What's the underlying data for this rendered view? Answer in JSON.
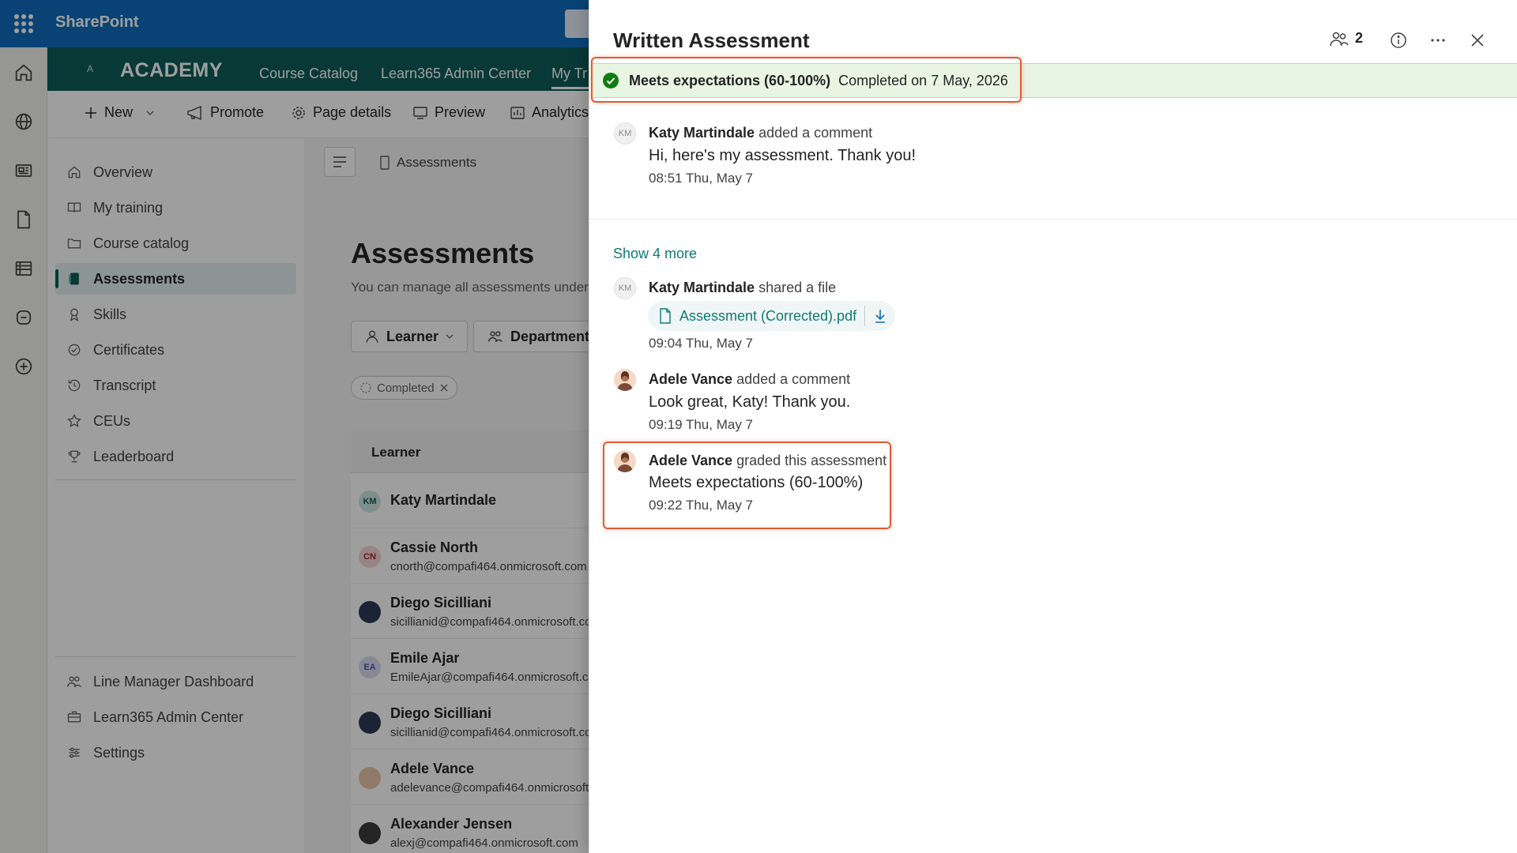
{
  "suite": {
    "title": "SharePoint"
  },
  "site": {
    "logo_text": "A",
    "name": "ACADEMY",
    "nav": [
      "Course Catalog",
      "Learn365 Admin Center",
      "My Tr"
    ]
  },
  "commands": {
    "new": "New",
    "promote": "Promote",
    "page_details": "Page details",
    "preview": "Preview",
    "analytics": "Analytics"
  },
  "leftnav": {
    "items": [
      "Overview",
      "My training",
      "Course catalog",
      "Assessments",
      "Skills",
      "Certificates",
      "Transcript",
      "CEUs",
      "Leaderboard"
    ],
    "selected": "Assessments",
    "bottom": [
      "Line Manager Dashboard",
      "Learn365 Admin Center",
      "Settings"
    ]
  },
  "main": {
    "breadcrumb": "Assessments",
    "title": "Assessments",
    "subtitle": "You can manage all assessments under",
    "filters": {
      "learner": "Learner",
      "department": "Department"
    },
    "chip": "Completed",
    "table_header": "Learner",
    "rows": [
      {
        "initials": "KM",
        "name": "Katy Martindale",
        "email": ""
      },
      {
        "initials": "CN",
        "name": "Cassie North",
        "email": "cnorth@compafi464.onmicrosoft.com"
      },
      {
        "initials": "",
        "name": "Diego Sicilliani",
        "email": "sicillianid@compafi464.onmicrosoft.co"
      },
      {
        "initials": "EA",
        "name": "Emile Ajar",
        "email": "EmileAjar@compafi464.onmicrosoft.co"
      },
      {
        "initials": "",
        "name": "Diego Sicilliani",
        "email": "sicillianid@compafi464.onmicrosoft.co"
      },
      {
        "initials": "",
        "name": "Adele Vance",
        "email": "adelevance@compafi464.onmicrosoft"
      },
      {
        "initials": "",
        "name": "Alexander Jensen",
        "email": "alexj@compafi464.onmicrosoft.com"
      }
    ]
  },
  "panel": {
    "title": "Written Assessment",
    "participants_count": "2",
    "status": {
      "grade": "Meets expectations (60-100%)",
      "completed": "Completed on 7 May, 2026"
    },
    "feed": {
      "c1": {
        "initials": "KM",
        "author": "Katy Martindale",
        "action": "added a comment",
        "body": "Hi, here's my assessment. Thank you!",
        "time": "08:51 Thu, May 7"
      },
      "show_more": "Show 4 more",
      "c2": {
        "initials": "KM",
        "author": "Katy Martindale",
        "action": "shared a file",
        "file": "Assessment (Corrected).pdf",
        "time": "09:04 Thu, May 7"
      },
      "c3": {
        "author": "Adele Vance",
        "action": "added a comment",
        "body": "Look great, Katy! Thank you.",
        "time": "09:19 Thu, May 7"
      },
      "c4": {
        "author": "Adele Vance",
        "action": "graded this assessment",
        "body": "Meets expectations (60-100%)",
        "time": "09:22 Thu, May 7"
      }
    }
  },
  "colors": {
    "suite_bar": "#0f6cbd",
    "site_header": "#0e5c5a",
    "accent_teal": "#0e7a73",
    "success": "#107c10",
    "highlight": "#e15a32"
  }
}
